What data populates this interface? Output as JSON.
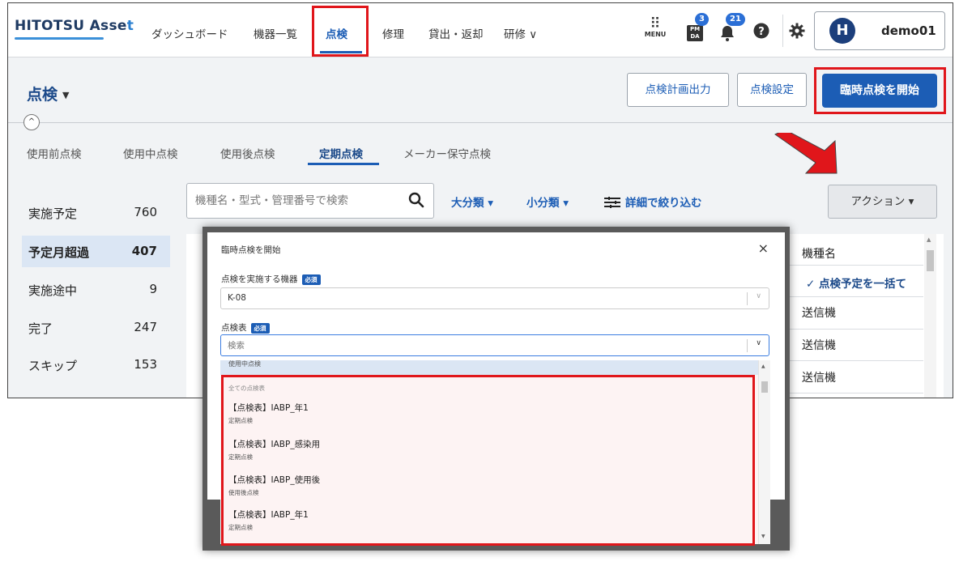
{
  "topnav": {
    "logo_main": "HITOTSU Asse",
    "logo_accent": "t",
    "items": [
      {
        "label": "ダッシュボード"
      },
      {
        "label": "機器一覧"
      },
      {
        "label": "点検"
      },
      {
        "label": "修理"
      },
      {
        "label": "貸出・返却"
      },
      {
        "label": "研修 ∨"
      }
    ],
    "menu_label": "MENU",
    "pmda_label": "PM DA",
    "pmda_badge": "3",
    "notification_badge": "21",
    "user_initial": "H",
    "username": "demo01"
  },
  "header": {
    "title": "点検",
    "plan_output_button": "点検計画出力",
    "settings_button": "点検設定",
    "start_button": "臨時点検を開始"
  },
  "tabs": [
    {
      "label": "使用前点検"
    },
    {
      "label": "使用中点検"
    },
    {
      "label": "使用後点検"
    },
    {
      "label": "定期点検"
    },
    {
      "label": "メーカー保守点検"
    }
  ],
  "statuses": [
    {
      "label": "実施予定",
      "count": "760"
    },
    {
      "label": "予定月超過",
      "count": "407"
    },
    {
      "label": "実施途中",
      "count": "9"
    },
    {
      "label": "完了",
      "count": "247"
    },
    {
      "label": "スキップ",
      "count": "153"
    }
  ],
  "toolbar": {
    "search_placeholder": "機種名・型式・管理番号で検索",
    "major_category": "大分類 ▾",
    "minor_category": "小分類 ▾",
    "detail_filter": "詳細で絞り込む",
    "action_button": "アクション ▾"
  },
  "table": {
    "column_header": "機種名",
    "bulk_action": "点検予定を一括て",
    "rows": [
      "送信機",
      "送信機",
      "送信機"
    ]
  },
  "dialog": {
    "title": "臨時点検を開始",
    "close": "×",
    "device_label": "点検を実施する機器",
    "required": "必須",
    "device_value": "K-08",
    "sheet_label": "点検表",
    "sheet_placeholder": "検索",
    "dropdown": {
      "partial_item": "使用中点検",
      "group_label": "全ての点検表",
      "items": [
        {
          "name": "【点検表】IABP_年1",
          "type": "定期点検"
        },
        {
          "name": "【点検表】IABP_感染用",
          "type": "定期点検"
        },
        {
          "name": "【点検表】IABP_使用後",
          "type": "使用後点検"
        },
        {
          "name": "【点検表】IABP_年1",
          "type": "定期点検"
        }
      ]
    }
  },
  "colors": {
    "primary": "#1c5db5",
    "highlight_red": "#e0161b",
    "selected_row": "#dbe6f4"
  }
}
